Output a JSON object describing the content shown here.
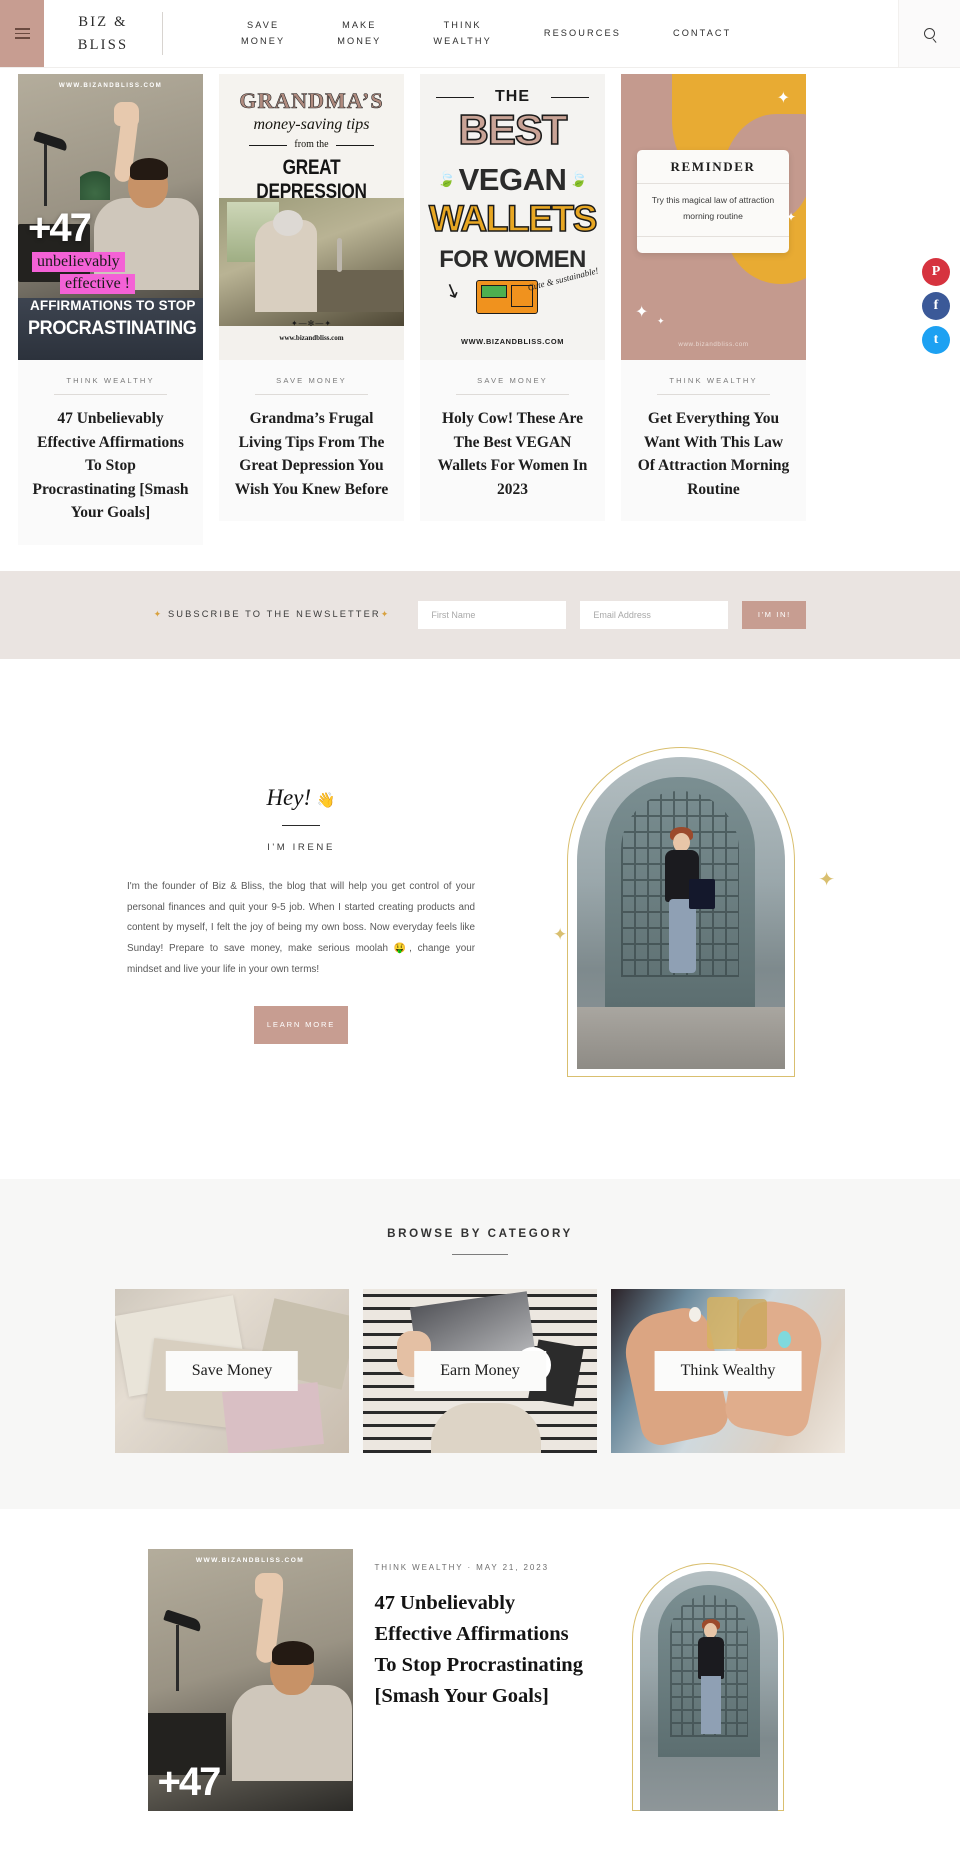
{
  "header": {
    "menu_icon": "hamburger-icon",
    "brand_line1": "BIZ &",
    "brand_line2": "BLISS",
    "nav": [
      {
        "label": "SAVE\nMONEY"
      },
      {
        "label": "MAKE\nMONEY"
      },
      {
        "label": "THINK\nWEALTHY"
      },
      {
        "label": "RESOURCES"
      },
      {
        "label": "CONTACT"
      }
    ],
    "search_icon": "search-icon"
  },
  "social": [
    {
      "name": "pinterest",
      "glyph": "P",
      "color": "#d6333f"
    },
    {
      "name": "facebook",
      "glyph": "f",
      "color": "#3b5998"
    },
    {
      "name": "twitter",
      "glyph": "t",
      "color": "#1da1f2"
    }
  ],
  "featured": [
    {
      "category": "THINK WEALTHY",
      "title": "47 Unbelievably Effective Affirmations To Stop Procrastinating [Smash Your Goals]",
      "pin": {
        "url": "WWW.BIZANDBLISS.COM",
        "number": "+47",
        "highlight1": "unbelievably",
        "highlight2": "effective !",
        "line1": "AFFIRMATIONS TO STOP",
        "line2": "PROCRASTINATING"
      }
    },
    {
      "category": "SAVE MONEY",
      "title": "Grandma’s Frugal Living Tips From The Great Depression You Wish You Knew Before",
      "pin": {
        "l1": "GRANDMA’S",
        "l2": "money-saving tips",
        "l3": "from the",
        "l4": "GREAT DEPRESSION",
        "url": "www.bizandbliss.com",
        "ornament": "✦—✻—✦"
      }
    },
    {
      "category": "SAVE MONEY",
      "title": "Holy Cow! These Are The Best VEGAN Wallets For Women In 2023",
      "pin": {
        "the": "THE",
        "best": "BEST",
        "vegan": "VEGAN",
        "wallets": "WALLETS",
        "forwomen": "FOR WOMEN",
        "badge": "Cute & sustainable!",
        "url": "WWW.BIZANDBLISS.COM"
      }
    },
    {
      "category": "THINK WEALTHY",
      "title": "Get Everything You Want With This Law Of Attraction Morning Routine",
      "pin": {
        "card_header": "REMINDER",
        "card_body": "Try this magical law of attraction morning routine",
        "url": "www.bizandbliss.com"
      }
    }
  ],
  "newsletter": {
    "label": "SUBSCRIBE TO THE NEWSLETTER",
    "star_left": "✦",
    "star_right": "✦",
    "first_name_placeholder": "First Name",
    "first_name_value": "",
    "email_placeholder": "Email Address",
    "email_value": "",
    "submit_label": "I'M IN!"
  },
  "about": {
    "greeting": "Hey!",
    "greeting_emoji": "👋",
    "subtitle": "I'M IRENE",
    "body": "I'm the founder of Biz & Bliss, the blog that will help you get control of your personal finances and quit your 9-5 job. When I started creating products and content by myself, I felt the joy of being my own boss. Now everyday feels like Sunday! Prepare to save money, make serious moolah 🤑, change your mindset and live your life in your own terms!",
    "button_label": "LEARN\nMORE"
  },
  "categories": {
    "title": "BROWSE BY CATEGORY",
    "items": [
      {
        "label": "Save Money"
      },
      {
        "label": "Earn Money"
      },
      {
        "label": "Think Wealthy"
      }
    ]
  },
  "posts": [
    {
      "meta": "THINK WEALTHY · MAY 21, 2023",
      "title": "47 Unbelievably Effective Affirmations To Stop Procrastinating [Smash Your Goals]",
      "thumb_url": "WWW.BIZANDBLISS.COM",
      "thumb_number": "+47"
    }
  ],
  "colors": {
    "accent": "#c79d91",
    "newsletter_bg": "#eae4e1",
    "category_bg": "#f7f7f6",
    "gold": "#d9bf6f"
  }
}
